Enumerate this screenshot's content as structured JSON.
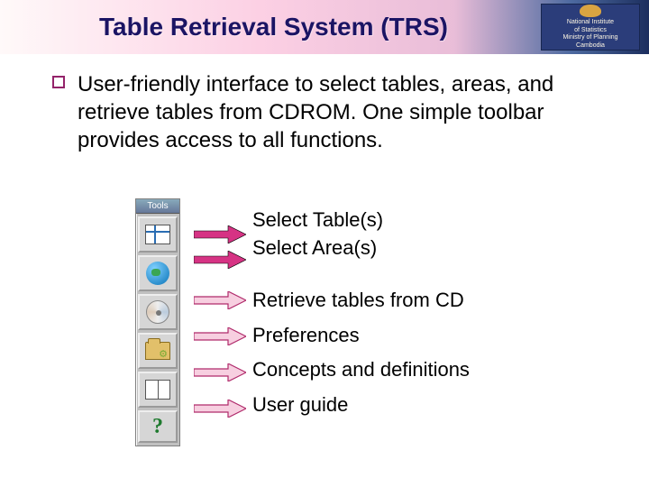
{
  "title": "Table Retrieval System (TRS)",
  "logo": {
    "line1": "National Institute",
    "line2": "of Statistics",
    "line3": "Ministry of Planning",
    "line4": "Cambodia"
  },
  "intro": "User-friendly interface to select tables, areas, and retrieve tables from CDROM. One simple toolbar provides access to all functions.",
  "toolbar": {
    "header": "Tools",
    "items": [
      {
        "icon": "table-icon",
        "label": "Select Table(s)"
      },
      {
        "icon": "globe-icon",
        "label": "Select Area(s)"
      },
      {
        "icon": "cd-icon",
        "label": "Retrieve tables from CD"
      },
      {
        "icon": "folder-icon",
        "label": "Preferences"
      },
      {
        "icon": "book-icon",
        "label": "Concepts and definitions"
      },
      {
        "icon": "help-icon",
        "label": "User guide"
      }
    ]
  }
}
